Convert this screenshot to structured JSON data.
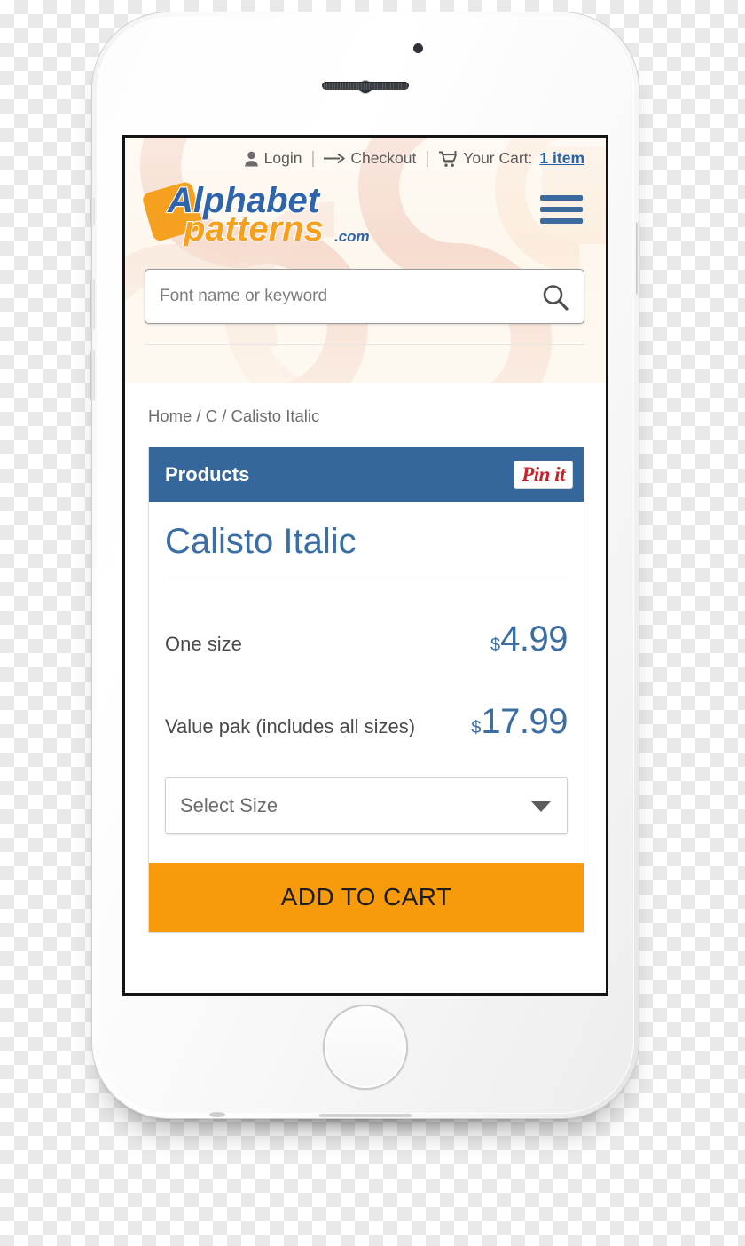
{
  "site": {
    "utility_bar": {
      "login_label": "Login",
      "login_icon": "user-icon",
      "separator": "|",
      "checkout_label": "Checkout",
      "checkout_icon": "arrow-right-icon",
      "cart_icon": "shopping-cart-icon",
      "cart_label": "Your Cart:",
      "cart_count": "1 item"
    },
    "logo": {
      "name": "alphabet-patterns-logo",
      "word_one": "Alphabet",
      "word_two": "patterns",
      "suffix": ".com",
      "mark_color": "#f5a01f",
      "word_one_color": "#2f64ab",
      "word_two_color": "#f5a01f"
    },
    "menu_toggle": {
      "icon": "hamburger-menu-icon",
      "color": "#3a6a9e"
    },
    "search": {
      "placeholder": "Font name or keyword",
      "value": "",
      "icon": "search-icon"
    }
  },
  "breadcrumb": {
    "text": "Home / C / Calisto Italic",
    "items": [
      "Home",
      "C",
      "Calisto Italic"
    ]
  },
  "product_card": {
    "header_title": "Products",
    "header_color": "#35679c",
    "pinit": {
      "label": "Pin it",
      "icon": "pinterest-pin-it-button",
      "color": "#c8232c"
    },
    "product_name": "Calisto Italic",
    "product_name_color": "#3b6ea5",
    "prices": [
      {
        "label": "One size",
        "currency": "$",
        "value": "4.99"
      },
      {
        "label": "Value pak (includes all sizes)",
        "currency": "$",
        "value": "17.99"
      }
    ],
    "size_select": {
      "selected": "Select Size",
      "caret_icon": "chevron-down-icon"
    },
    "add_to_cart": {
      "label": "ADD TO CART",
      "color": "#f79b0c"
    }
  },
  "device": {
    "name": "white-smartphone-mockup",
    "front_camera": "front-camera",
    "earpiece": "earpiece-speaker",
    "home_button": "home-button",
    "buttons": [
      "silent-switch",
      "volume-up",
      "volume-down",
      "power-button"
    ]
  }
}
